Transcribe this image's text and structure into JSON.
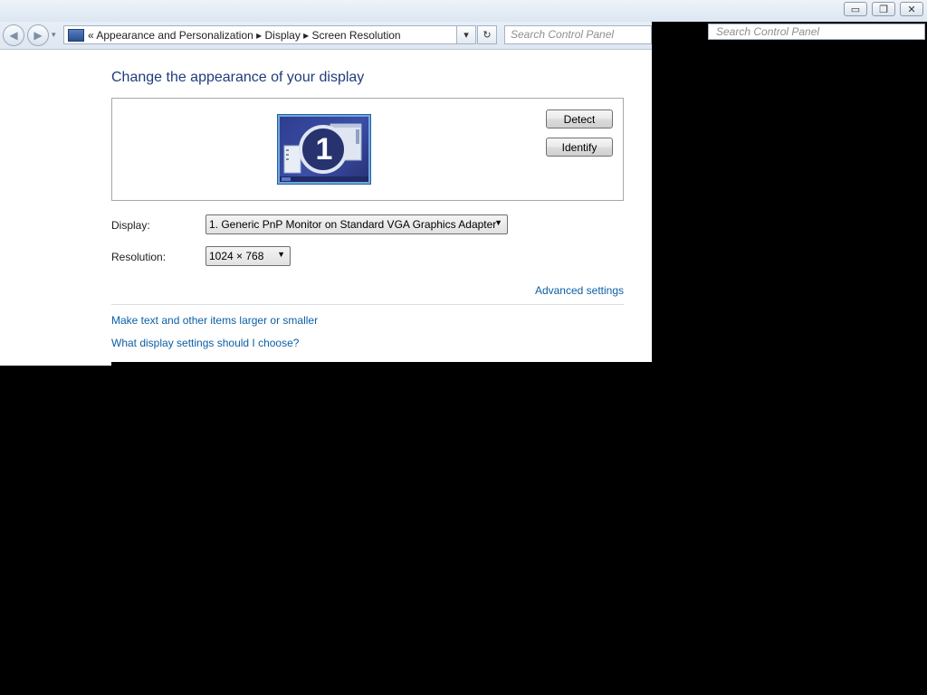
{
  "window": {
    "minimize_glyph": "▭",
    "restore_glyph": "❐",
    "close_glyph": "✕"
  },
  "navigation": {
    "back_glyph": "◀",
    "forward_glyph": "▶",
    "history_dropdown_glyph": "▾",
    "address_text": "« Appearance and Personalization ▸ Display ▸ Screen Resolution",
    "address_dropdown_glyph": "▾",
    "refresh_glyph": "↻",
    "search_placeholder": "Search Control Panel",
    "search_placeholder_2": "Search Control Panel"
  },
  "page": {
    "title": "Change the appearance of your display",
    "monitor_number": "1",
    "detect_label": "Detect",
    "identify_label": "Identify",
    "display_label": "Display:",
    "display_value": "1. Generic PnP Monitor on Standard VGA Graphics Adapter",
    "resolution_label": "Resolution:",
    "resolution_value": "1024 × 768",
    "dropdown_glyph": "▼",
    "advanced_link": "Advanced settings",
    "links": [
      "Make text and other items larger or smaller",
      "What display settings should I choose?"
    ]
  },
  "icons": {
    "control_panel": "control-panel-icon",
    "monitor": "monitor-icon"
  },
  "colors": {
    "title": "#1f3c7b",
    "link": "#0b5fa5",
    "background": "#ffffff",
    "outside": "#000000"
  }
}
